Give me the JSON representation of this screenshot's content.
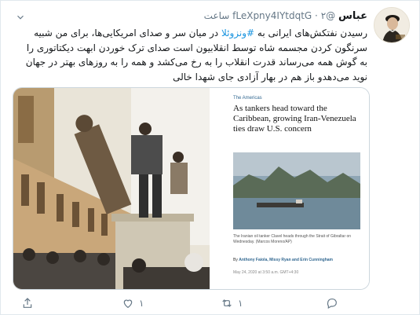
{
  "tweet": {
    "display_name": "عباس",
    "handle": "@fLeXpny4IYtdqtG",
    "separator": "·",
    "time": "۲ ساعت",
    "text_before_hashtag": "رسیدن نفتکش‌های ایرانی به ",
    "hashtag": "#ونزوئلا",
    "text_after_hashtag": " در میان سر و صدای امریکایی‌ها، برای من شبیه سرنگون کردن مجسمه شاه توسط انقلابیون است صدای ترک خوردن ابهت دیکتاتوری را به گوش همه می‌رساند قدرت انقلاب را به رخ می‌کشد و همه را به روزهای بهتر در جهان نوید می‌دهدو باز هم در بهار آزادی جای شهدا خالی"
  },
  "article": {
    "section": "The Americas",
    "headline": "As tankers head toward the Caribbean, growing Iran-Venezuela ties draw U.S. concern",
    "caption": "The Iranian oil tanker Clavel heads through the Strait of Gibraltar on Wednesday. (Marcos Moreno/AP)",
    "by": "By",
    "authors": "Anthony Faiola, Missy Ryan and Erin Cunningham",
    "date": "May 24, 2020 at 3:50 a.m. GMT+4:30"
  },
  "actions": {
    "reply_count": "",
    "retweet_count": "۱",
    "like_count": "۱"
  },
  "colors": {
    "link": "#1b95e0",
    "muted": "#657786",
    "border": "#e1e8ed"
  }
}
